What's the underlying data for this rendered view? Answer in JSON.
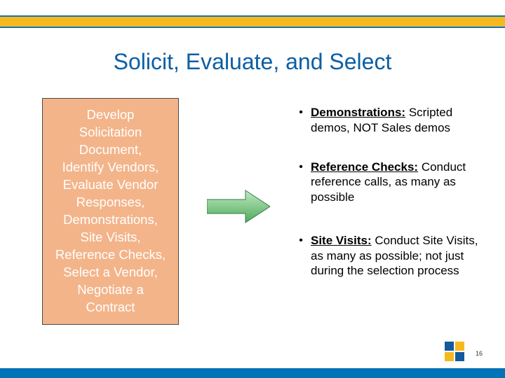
{
  "title": "Solicit, Evaluate, and Select",
  "process_box": {
    "l1": "Develop",
    "l2": "Solicitation",
    "l3": "Document,",
    "l4": "Identify Vendors,",
    "l5": "Evaluate Vendor",
    "l6": "Responses,",
    "l7": "Demonstrations,",
    "l8": "Site Visits,",
    "l9": "Reference Checks,",
    "l10": "Select a Vendor,",
    "l11": "Negotiate a",
    "l12": "Contract"
  },
  "bullets": [
    {
      "head": "Demonstrations:",
      "text": "Scripted demos, NOT Sales demos"
    },
    {
      "head": "Reference Checks:",
      "text": "Conduct reference calls, as many as possible"
    },
    {
      "head": "Site Visits:",
      "text": "Conduct Site Visits, as many as possible; not just during the selection process"
    }
  ],
  "page_number": "16"
}
